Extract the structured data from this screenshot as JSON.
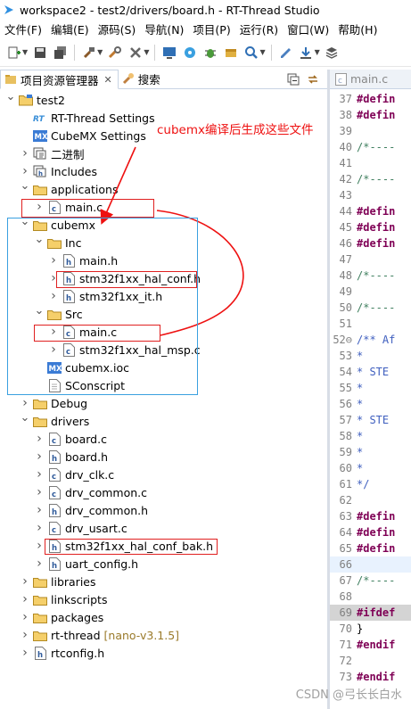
{
  "window": {
    "title": "workspace2 - test2/drivers/board.h - RT-Thread Studio"
  },
  "menu": [
    {
      "label": "文件(F)"
    },
    {
      "label": "编辑(E)"
    },
    {
      "label": "源码(S)"
    },
    {
      "label": "导航(N)"
    },
    {
      "label": "项目(P)"
    },
    {
      "label": "运行(R)"
    },
    {
      "label": "窗口(W)"
    },
    {
      "label": "帮助(H)"
    }
  ],
  "toolbar": {
    "icons": [
      "new-icon",
      "save-icon",
      "save-all-icon",
      "build-icon",
      "debug-config-icon",
      "tools-icon",
      "terminal-icon",
      "sdk-manager-icon",
      "bug-icon",
      "package-icon",
      "search-icon",
      "settings-icon",
      "download-icon",
      "layers-icon"
    ]
  },
  "project_view": {
    "tabs": [
      {
        "label": "项目资源管理器",
        "active": true,
        "close": "✕"
      },
      {
        "label": "搜索",
        "active": false
      }
    ],
    "tree": [
      {
        "label": "test2",
        "kind": "project",
        "depth": 0,
        "expanded": true
      },
      {
        "label": "RT-Thread Settings",
        "kind": "rt",
        "depth": 1
      },
      {
        "label": "CubeMX Settings",
        "kind": "mx",
        "depth": 1
      },
      {
        "label": "二进制",
        "kind": "binaries",
        "depth": 1,
        "expanded": false
      },
      {
        "label": "Includes",
        "kind": "includes",
        "depth": 1,
        "expanded": false
      },
      {
        "label": "applications",
        "kind": "folder",
        "depth": 1,
        "expanded": true
      },
      {
        "label": "main.c",
        "kind": "c",
        "depth": 2,
        "expanded": false
      },
      {
        "label": "cubemx",
        "kind": "folder",
        "depth": 1,
        "expanded": true
      },
      {
        "label": "Inc",
        "kind": "folder",
        "depth": 2,
        "expanded": true
      },
      {
        "label": "main.h",
        "kind": "h",
        "depth": 3,
        "expanded": false
      },
      {
        "label": "stm32f1xx_hal_conf.h",
        "kind": "h",
        "depth": 3,
        "expanded": false
      },
      {
        "label": "stm32f1xx_it.h",
        "kind": "h",
        "depth": 3,
        "expanded": false
      },
      {
        "label": "Src",
        "kind": "folder",
        "depth": 2,
        "expanded": true
      },
      {
        "label": "main.c",
        "kind": "c",
        "depth": 3,
        "expanded": false
      },
      {
        "label": "stm32f1xx_hal_msp.c",
        "kind": "c",
        "depth": 3,
        "expanded": false
      },
      {
        "label": "cubemx.ioc",
        "kind": "mx",
        "depth": 2
      },
      {
        "label": "SConscript",
        "kind": "file",
        "depth": 2
      },
      {
        "label": "Debug",
        "kind": "folder",
        "depth": 1,
        "expanded": false
      },
      {
        "label": "drivers",
        "kind": "folder",
        "depth": 1,
        "expanded": true
      },
      {
        "label": "board.c",
        "kind": "c",
        "depth": 2,
        "expanded": false
      },
      {
        "label": "board.h",
        "kind": "h",
        "depth": 2,
        "expanded": false
      },
      {
        "label": "drv_clk.c",
        "kind": "c",
        "depth": 2,
        "expanded": false
      },
      {
        "label": "drv_common.c",
        "kind": "c",
        "depth": 2,
        "expanded": false
      },
      {
        "label": "drv_common.h",
        "kind": "h",
        "depth": 2,
        "expanded": false
      },
      {
        "label": "drv_usart.c",
        "kind": "c",
        "depth": 2,
        "expanded": false
      },
      {
        "label": "stm32f1xx_hal_conf_bak.h",
        "kind": "h",
        "depth": 2,
        "expanded": false
      },
      {
        "label": "uart_config.h",
        "kind": "h",
        "depth": 2,
        "expanded": false
      },
      {
        "label": "libraries",
        "kind": "folder",
        "depth": 1,
        "expanded": false
      },
      {
        "label": "linkscripts",
        "kind": "folder",
        "depth": 1,
        "expanded": false
      },
      {
        "label": "packages",
        "kind": "folder",
        "depth": 1,
        "expanded": false
      },
      {
        "label": "rt-thread",
        "kind": "folder",
        "depth": 1,
        "expanded": false,
        "extra": "[nano-v3.1.5]"
      },
      {
        "label": "rtconfig.h",
        "kind": "h",
        "depth": 1,
        "expanded": false
      }
    ]
  },
  "editor": {
    "tab_label": "main.c",
    "lines": [
      {
        "num": "37",
        "code": "#defin",
        "style": "kw"
      },
      {
        "num": "38",
        "code": "#defin",
        "style": "kw"
      },
      {
        "num": "39",
        "code": "",
        "style": ""
      },
      {
        "num": "40",
        "code": "/*----",
        "style": "cm"
      },
      {
        "num": "41",
        "code": "",
        "style": ""
      },
      {
        "num": "42",
        "code": "/*----",
        "style": "cm"
      },
      {
        "num": "43",
        "code": "",
        "style": ""
      },
      {
        "num": "44",
        "code": "#defin",
        "style": "kw"
      },
      {
        "num": "45",
        "code": "#defin",
        "style": "kw"
      },
      {
        "num": "46",
        "code": "#defin",
        "style": "kw"
      },
      {
        "num": "47",
        "code": "",
        "style": ""
      },
      {
        "num": "48",
        "code": "/*----",
        "style": "cm"
      },
      {
        "num": "49",
        "code": "",
        "style": ""
      },
      {
        "num": "50",
        "code": "/*----",
        "style": "cm"
      },
      {
        "num": "51",
        "code": "",
        "style": ""
      },
      {
        "num": "52⊖",
        "code": "/** Af",
        "style": "doc"
      },
      {
        "num": "53",
        "code": " *",
        "style": "doc"
      },
      {
        "num": "54",
        "code": " * STE",
        "style": "doc"
      },
      {
        "num": "55",
        "code": " *",
        "style": "doc"
      },
      {
        "num": "56",
        "code": " *",
        "style": "doc"
      },
      {
        "num": "57",
        "code": " * STE",
        "style": "doc"
      },
      {
        "num": "58",
        "code": " *",
        "style": "doc"
      },
      {
        "num": "59",
        "code": " *",
        "style": "doc"
      },
      {
        "num": "60",
        "code": " *",
        "style": "doc"
      },
      {
        "num": "61",
        "code": " */",
        "style": "doc"
      },
      {
        "num": "62",
        "code": "",
        "style": ""
      },
      {
        "num": "63",
        "code": "#defin",
        "style": "kw"
      },
      {
        "num": "64",
        "code": "#defin",
        "style": "kw"
      },
      {
        "num": "65",
        "code": "#defin",
        "style": "kw"
      },
      {
        "num": "66",
        "code": "",
        "style": "hl"
      },
      {
        "num": "67",
        "code": "/*----",
        "style": "cm"
      },
      {
        "num": "68",
        "code": "",
        "style": ""
      },
      {
        "num": "69",
        "code": "#ifdef",
        "style": "kw",
        "grey": true
      },
      {
        "num": "70",
        "code": "}",
        "style": ""
      },
      {
        "num": "71",
        "code": "#endif",
        "style": "kw"
      },
      {
        "num": "72",
        "code": "",
        "style": ""
      },
      {
        "num": "73",
        "code": "#endif",
        "style": "kw"
      }
    ]
  },
  "annotation": {
    "text": "cubemx编译后生成这些文件",
    "color": "#ee1111"
  },
  "watermark": "CSDN @弓长长白水"
}
